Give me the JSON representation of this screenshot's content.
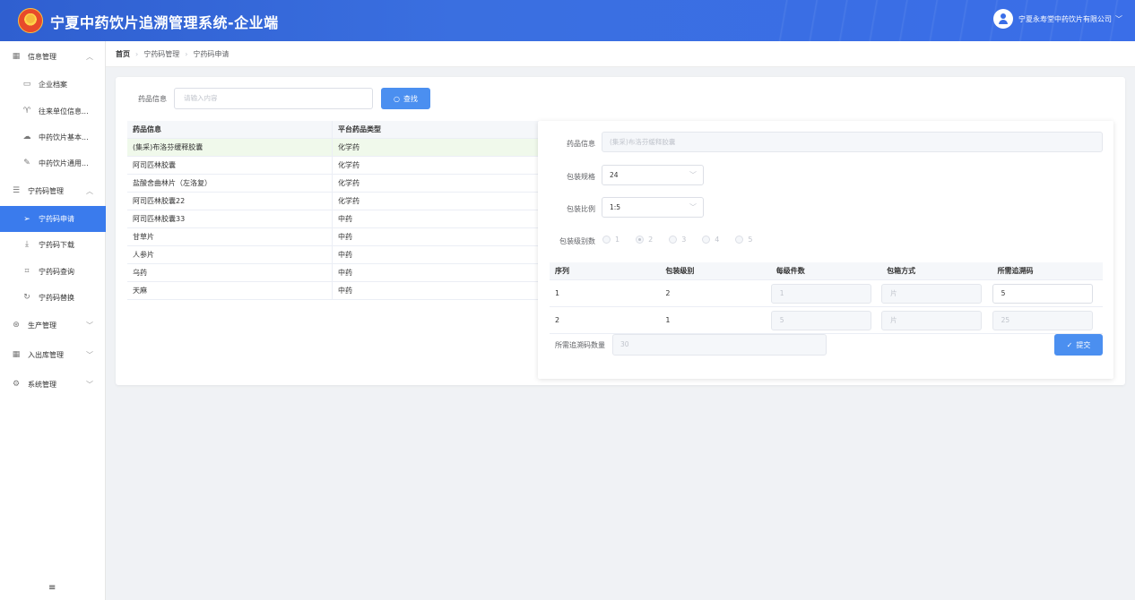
{
  "app": {
    "title": "宁夏中药饮片追溯管理系统-企业端",
    "user": "宁夏永寿堂中药饮片有限公司"
  },
  "sidebar": {
    "groups": [
      {
        "label": "信息管理",
        "icon": "grid-icon",
        "expanded": true,
        "items": [
          {
            "label": "企业档案",
            "icon": "folder-icon"
          },
          {
            "label": "往来单位信息...",
            "icon": "trophy-icon"
          },
          {
            "label": "中药饮片基本...",
            "icon": "cloud-icon"
          },
          {
            "label": "中药饮片通用...",
            "icon": "brush-icon"
          }
        ]
      },
      {
        "label": "宁药码管理",
        "icon": "list-icon",
        "expanded": true,
        "items": [
          {
            "label": "宁药码申请",
            "icon": "send-icon",
            "active": true
          },
          {
            "label": "宁药码下载",
            "icon": "download-icon"
          },
          {
            "label": "宁药码查询",
            "icon": "crop-icon"
          },
          {
            "label": "宁药码替换",
            "icon": "refresh-icon"
          }
        ]
      },
      {
        "label": "生产管理",
        "icon": "gear-circle-icon",
        "expanded": false
      },
      {
        "label": "入出库管理",
        "icon": "grid-icon",
        "expanded": false
      },
      {
        "label": "系统管理",
        "icon": "settings-icon",
        "expanded": false
      }
    ],
    "toggle": "≡"
  },
  "breadcrumb": [
    "首页",
    "宁药码管理",
    "宁药码申请"
  ],
  "search": {
    "label": "药品信息",
    "placeholder": "请输入内容",
    "button": "查找"
  },
  "table": {
    "headers": [
      "药品信息",
      "平台药品类型"
    ],
    "rows": [
      [
        "(集采)布洛芬缓释胶囊",
        "化学药"
      ],
      [
        "阿司匹林胶囊",
        "化学药"
      ],
      [
        "盐酸舍曲林片（左洛复）",
        "化学药"
      ],
      [
        "阿司匹林胶囊22",
        "化学药"
      ],
      [
        "阿司匹林胶囊33",
        "中药"
      ],
      [
        "甘草片",
        "中药"
      ],
      [
        "人参片",
        "中药"
      ],
      [
        "乌药",
        "中药"
      ],
      [
        "天麻",
        "中药"
      ]
    ],
    "selected_row": 0
  },
  "form": {
    "drug_label": "药品信息",
    "drug_value": "(集采)布洛芬缓释胶囊",
    "spec_label": "包装规格",
    "spec_value": "24",
    "ratio_label": "包装比例",
    "ratio_value": "1:5",
    "levels_label": "包装级别数",
    "levels": [
      "1",
      "2",
      "3",
      "4",
      "5"
    ],
    "levels_selected": "2",
    "sub_headers": [
      "序列",
      "包装级别",
      "每级件数",
      "包箱方式",
      "所需追溯码"
    ],
    "sub_rows": [
      {
        "seq": "1",
        "level": "2",
        "count": "1",
        "method": "片",
        "codes": "5"
      },
      {
        "seq": "2",
        "level": "1",
        "count": "5",
        "method": "片",
        "codes": "25"
      }
    ],
    "total_label": "所需追溯码数量",
    "total_value": "30",
    "submit": "提交"
  }
}
